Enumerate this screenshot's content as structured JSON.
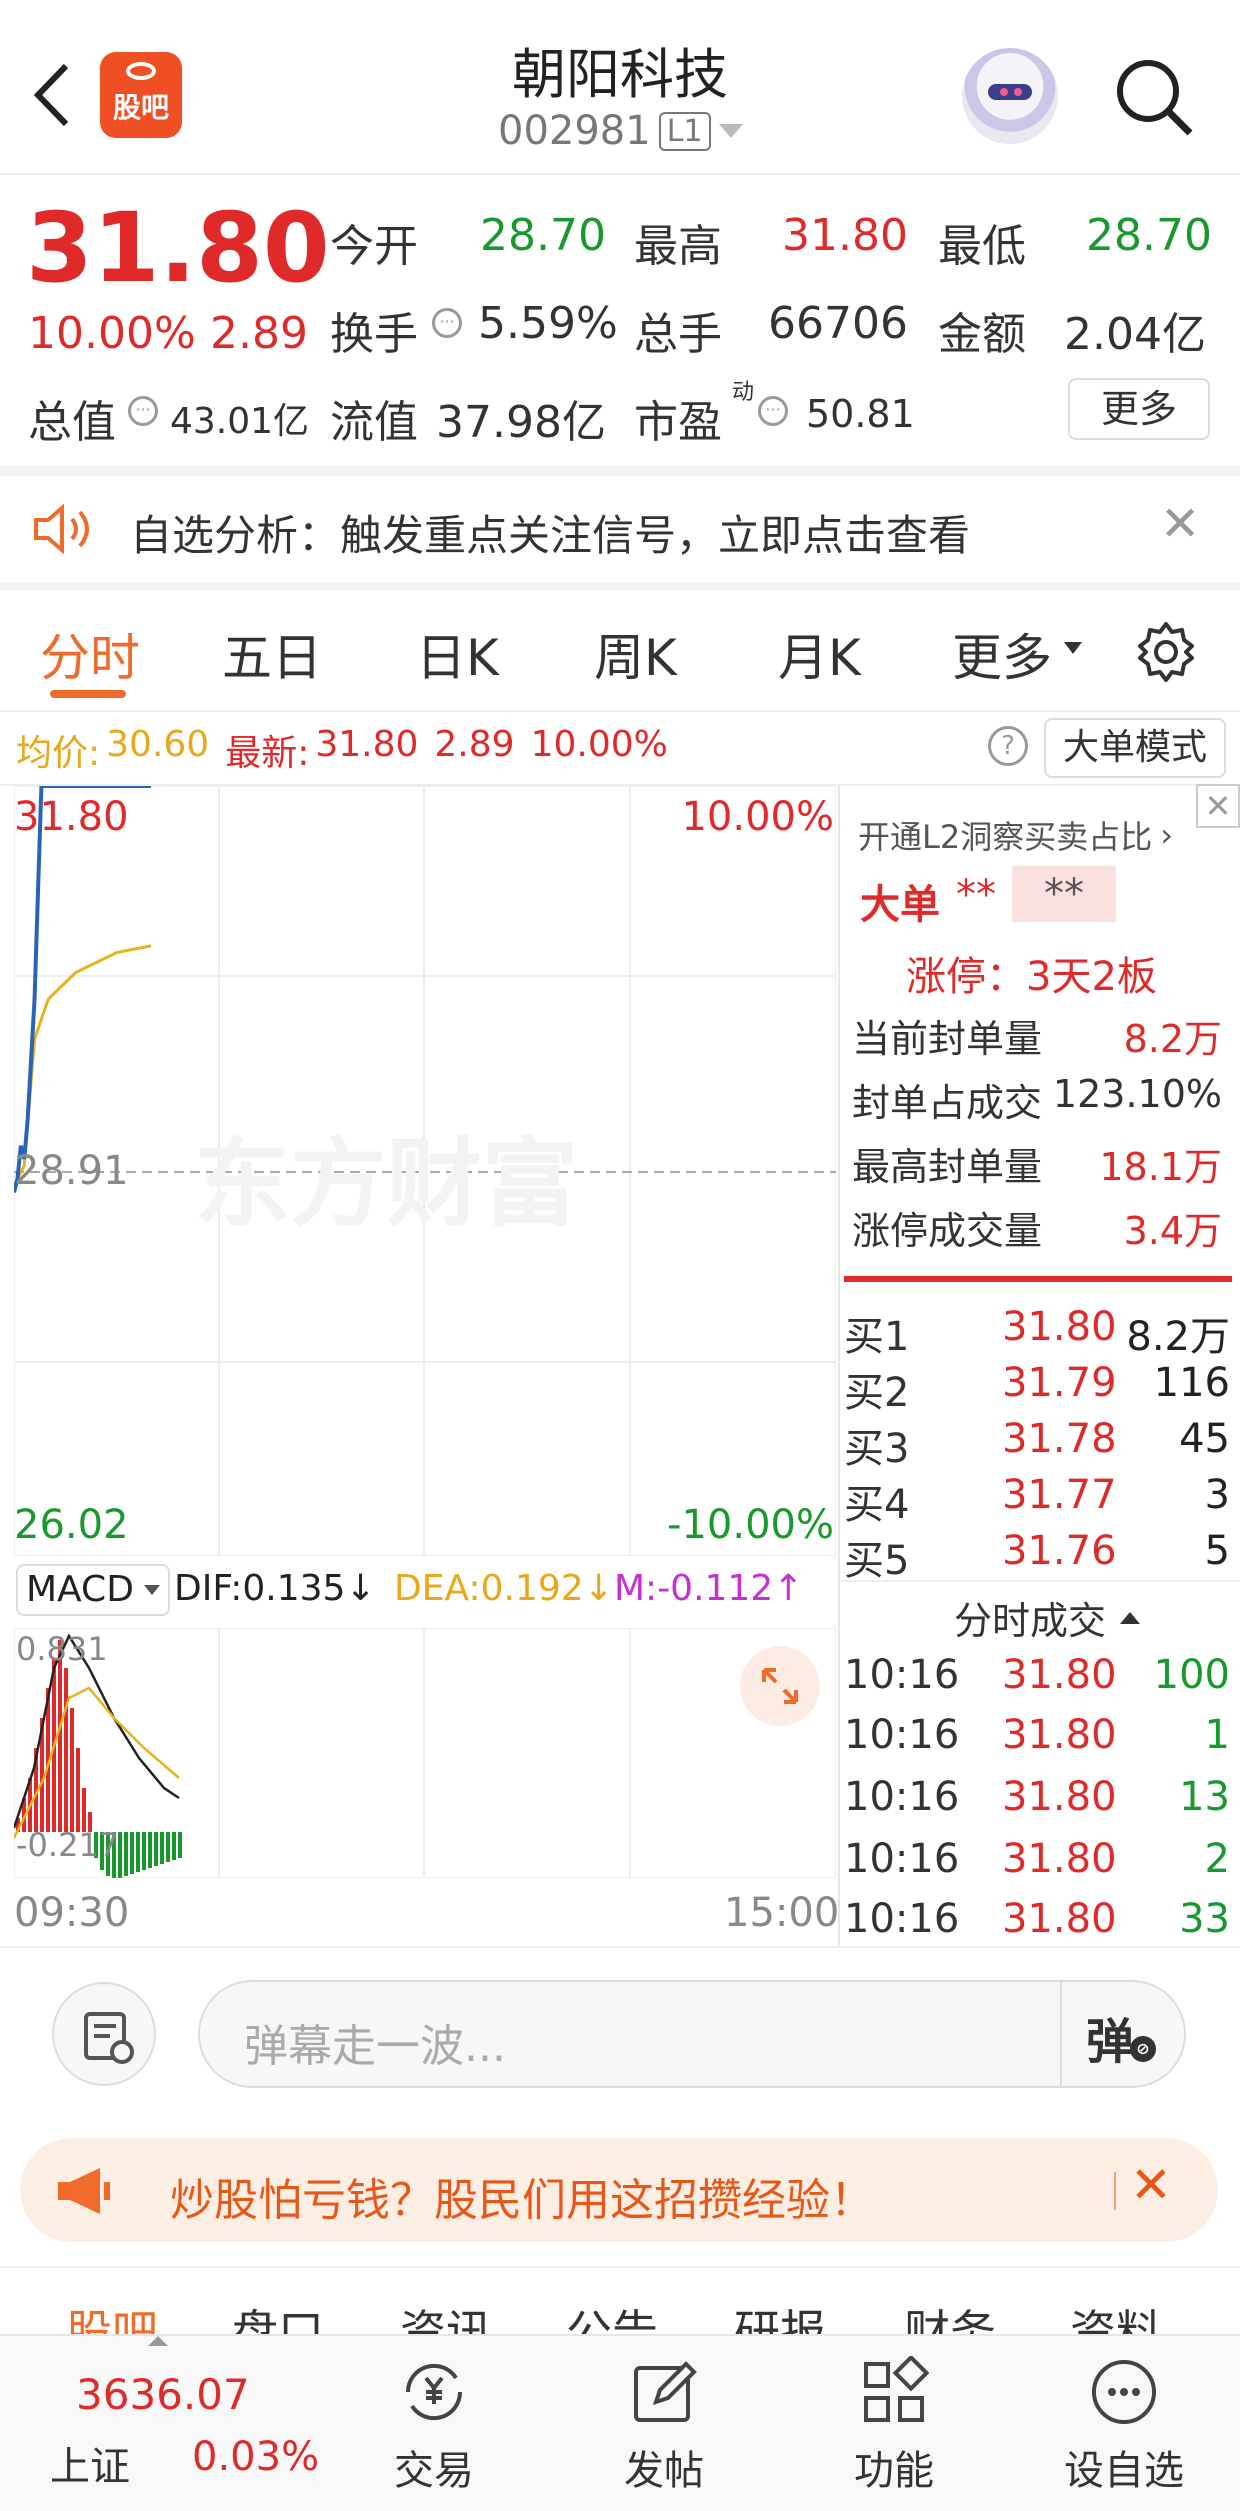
{
  "header": {
    "logo_text": "股吧",
    "title": "朝阳科技",
    "code": "002981",
    "level": "L1"
  },
  "quote": {
    "price": "31.80",
    "pct": "10.00%",
    "chg": "2.89",
    "open_label": "今开",
    "open": "28.70",
    "high_label": "最高",
    "high": "31.80",
    "low_label": "最低",
    "low": "28.70",
    "turnover_label": "换手",
    "turnover": "5.59%",
    "volume_label": "总手",
    "volume": "66706",
    "amount_label": "金额",
    "amount": "2.04亿",
    "mktcap_label": "总值",
    "mktcap": "43.01亿",
    "float_label": "流值",
    "float": "37.98亿",
    "pe_label": "市盈",
    "pe_sup": "动",
    "pe": "50.81",
    "more_label": "更多"
  },
  "notice": {
    "text": "自选分析：触发重点关注信号，立即点击查看"
  },
  "tabs": [
    "分时",
    "五日",
    "日K",
    "周K",
    "月K",
    "更多"
  ],
  "info_bar": {
    "avg_label": "均价:",
    "avg": "30.60",
    "latest_label": "最新:",
    "latest": "31.80",
    "chg": "2.89",
    "pct": "10.00%",
    "mode_label": "大单模式"
  },
  "chart": {
    "max_price": "31.80",
    "max_pct": "10.00%",
    "mid_price": "28.91",
    "min_price": "26.02",
    "min_pct": "-10.00%",
    "watermark": "东方财富",
    "start_time": "09:30",
    "end_time": "15:00"
  },
  "chart_data": {
    "type": "line",
    "x_range": [
      "09:30",
      "15:00"
    ],
    "ylim": [
      26.02,
      31.8
    ],
    "series": [],
    "price_points": [
      [
        0,
        28.75
      ],
      [
        1,
        28.85
      ],
      [
        2,
        29.1
      ],
      [
        3,
        29.0
      ],
      [
        4,
        29.3
      ],
      [
        6,
        30.2
      ],
      [
        8,
        31.8
      ],
      [
        15,
        31.8
      ],
      [
        40,
        31.8
      ]
    ],
    "avg_points": [
      [
        0,
        28.8
      ],
      [
        3,
        28.95
      ],
      [
        6,
        29.9
      ],
      [
        10,
        30.2
      ],
      [
        18,
        30.4
      ],
      [
        30,
        30.55
      ],
      [
        40,
        30.6
      ]
    ]
  },
  "macd": {
    "label": "MACD",
    "dif": "DIF:0.135↓",
    "dea": "DEA:0.192↓",
    "m": "M:-0.112↑",
    "top": "0.831",
    "bottom": "-0.217"
  },
  "side": {
    "l2_link": "开通L2洞察买卖占比",
    "big_label": "大单",
    "big_val1": "**",
    "big_val2": "**",
    "limit_title": "涨停：3天2板",
    "rows": [
      {
        "label": "当前封单量",
        "value": "8.2万"
      },
      {
        "label": "封单占成交",
        "value": "123.10%"
      },
      {
        "label": "最高封单量",
        "value": "18.1万"
      },
      {
        "label": "涨停成交量",
        "value": "3.4万"
      }
    ],
    "bids": [
      {
        "label": "买1",
        "price": "31.80",
        "vol": "8.2万"
      },
      {
        "label": "买2",
        "price": "31.79",
        "vol": "116"
      },
      {
        "label": "买3",
        "price": "31.78",
        "vol": "45"
      },
      {
        "label": "买4",
        "price": "31.77",
        "vol": "3"
      },
      {
        "label": "买5",
        "price": "31.76",
        "vol": "5"
      }
    ],
    "ticks_title": "分时成交",
    "ticks": [
      {
        "time": "10:16",
        "price": "31.80",
        "vol": "100"
      },
      {
        "time": "10:16",
        "price": "31.80",
        "vol": "1"
      },
      {
        "time": "10:16",
        "price": "31.80",
        "vol": "13"
      },
      {
        "time": "10:16",
        "price": "31.80",
        "vol": "2"
      },
      {
        "time": "10:16",
        "price": "31.80",
        "vol": "33"
      }
    ]
  },
  "comment": {
    "placeholder": "弹幕走一波...",
    "danmu_label": "弹"
  },
  "promo": {
    "text": "炒股怕亏钱？股民们用这招攒经验！"
  },
  "subtabs": [
    "股吧",
    "盘口",
    "资讯",
    "公告",
    "研报",
    "财务",
    "资料"
  ],
  "bottom_nav": {
    "index_value": "3636.07",
    "index_name": "上证",
    "index_pct": "0.03%",
    "items": [
      "交易",
      "发帖",
      "功能",
      "设自选"
    ]
  }
}
